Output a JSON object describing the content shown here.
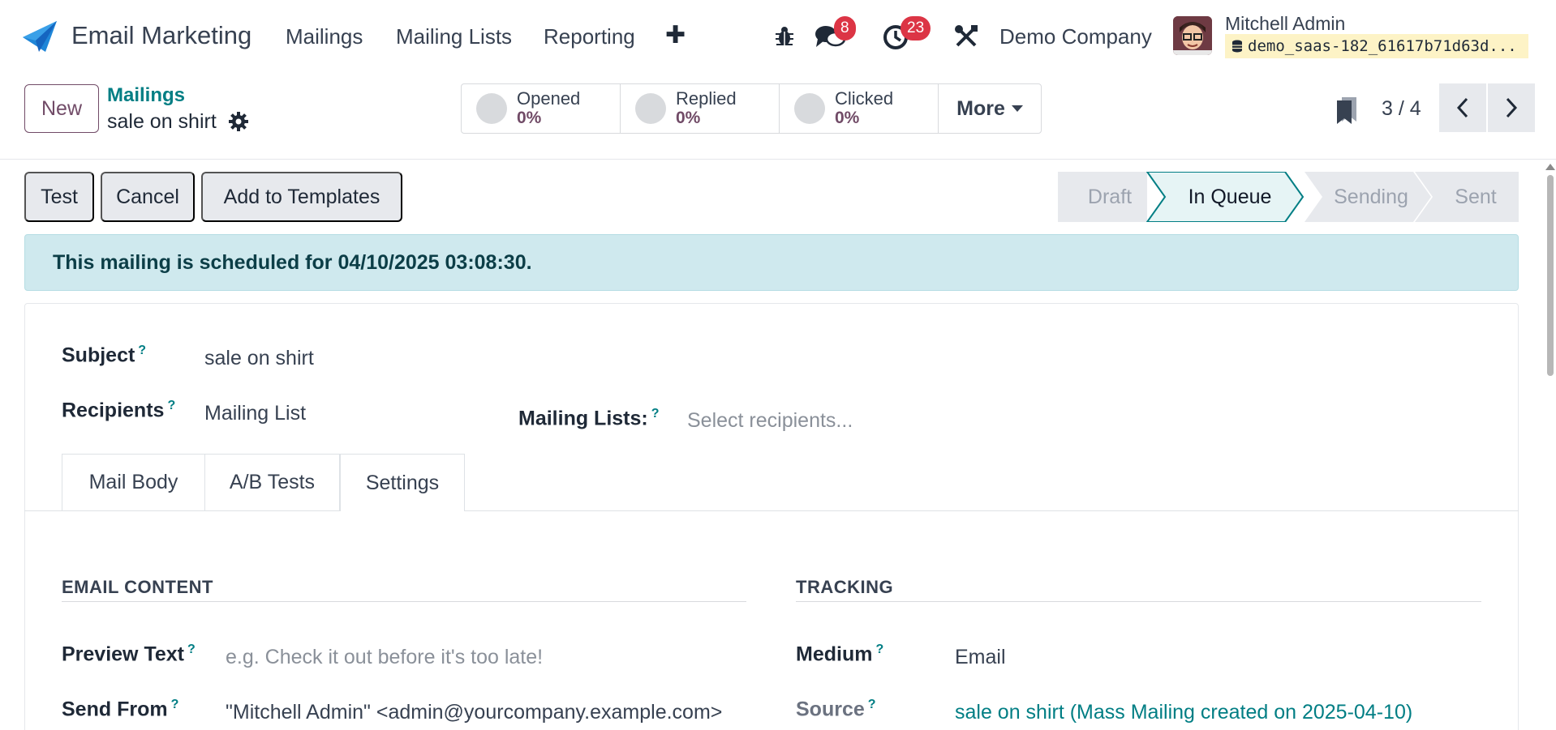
{
  "app": {
    "name": "Email Marketing"
  },
  "nav": {
    "menus": [
      "Mailings",
      "Mailing Lists",
      "Reporting"
    ],
    "plus": "✚",
    "messages_count": "8",
    "activities_count": "23",
    "company": "Demo Company",
    "user_name": "Mitchell Admin",
    "database": "demo_saas-182_61617b71d63d..."
  },
  "control": {
    "new_label": "New",
    "breadcrumb_parent": "Mailings",
    "breadcrumb_current": "sale on shirt",
    "stats": [
      {
        "label": "Opened",
        "value": "0%"
      },
      {
        "label": "Replied",
        "value": "0%"
      },
      {
        "label": "Clicked",
        "value": "0%"
      }
    ],
    "more_label": "More",
    "pager": "3 / 4"
  },
  "actions": {
    "test": "Test",
    "cancel": "Cancel",
    "add_templates": "Add to Templates"
  },
  "stages": [
    "Draft",
    "In Queue",
    "Sending",
    "Sent"
  ],
  "active_stage": "In Queue",
  "alert": "This mailing is scheduled for 04/10/2025 03:08:30.",
  "form": {
    "subject_label": "Subject",
    "subject_value": "sale on shirt",
    "recipients_label": "Recipients",
    "recipients_value": "Mailing List",
    "mailing_lists_label": "Mailing Lists:",
    "mailing_lists_placeholder": "Select recipients...",
    "tabs": [
      "Mail Body",
      "A/B Tests",
      "Settings"
    ],
    "active_tab": "Settings",
    "email_content_title": "EMAIL CONTENT",
    "tracking_title": "TRACKING",
    "preview_text_label": "Preview Text",
    "preview_text_placeholder": "e.g. Check it out before it's too late!",
    "send_from_label": "Send From",
    "send_from_value": "\"Mitchell Admin\" <admin@yourcompany.example.com>",
    "medium_label": "Medium",
    "medium_value": "Email",
    "source_label": "Source",
    "source_value": "sale on shirt (Mass Mailing created on 2025-04-10)"
  },
  "colors": {
    "primary": "#714b67",
    "link": "#017e84",
    "danger": "#dc3545",
    "alert_bg": "#cfe9ee"
  }
}
